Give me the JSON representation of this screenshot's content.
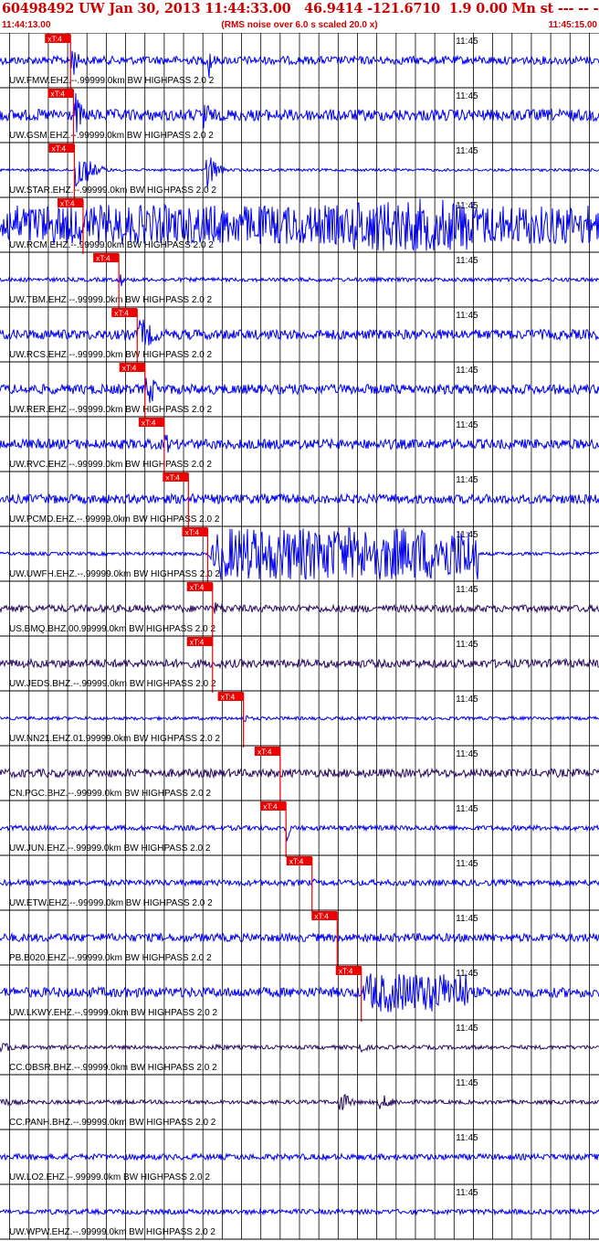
{
  "header": {
    "title": "60498492 UW Jan 30, 2013 11:44:33.00   46.9414 -121.6710  1.9 0.00 Mn st --- -- --  -1",
    "start_time": "11:44:13.00",
    "rms_note": "(RMS noise over 6.0 s scaled 20.0 x)",
    "end_time": "11:45:15.00"
  },
  "colors": {
    "trace_blue": "#0000ee",
    "trace_purple": "#2a0a60",
    "pick_marker": "#ee0000",
    "pick_label_text": "#ffffff",
    "grid": "#000000",
    "title_red": "#cc0000"
  },
  "chart_data": {
    "type": "line",
    "title": "60498492 UW Jan 30, 2013 11:44:33.00   46.9414 -121.6710  1.9 0.00 Mn st --- -- --  -1",
    "x_axis": {
      "start": "11:44:13.00",
      "end": "11:45:15.00",
      "minute_tick_label": "11:45",
      "minute_tick_time": "11:45:00"
    },
    "pick_label": "xT:4",
    "grid": "vertical gridlines every 2 s",
    "traces": [
      {
        "label": "UW.FMW.EHZ.--.99999.0km BW  HIGHPASS  2.0  2",
        "color": "trace_blue",
        "pick_time": "11:44:20.3",
        "amplitude": 0.25,
        "bursts": [
          [
            20.3,
            1.6,
            1.9
          ],
          [
            34.5,
            1.2,
            1.9
          ]
        ]
      },
      {
        "label": "UW.GSM.EHZ.--.99999.0km BW  HIGHPASS  2.0  2",
        "color": "trace_blue",
        "pick_time": "11:44:20.6",
        "amplitude": 0.35,
        "bursts": [
          [
            20.6,
            2.2,
            2.0
          ],
          [
            34.0,
            1.5,
            2.0
          ]
        ]
      },
      {
        "label": "UW.STAR.EHZ.--.99999.0km BW  HIGHPASS  2.0  2",
        "color": "trace_blue",
        "pick_time": "11:44:20.7",
        "amplitude": 0.08,
        "bursts": [
          [
            20.7,
            4.0,
            1.9
          ],
          [
            34.3,
            2.5,
            1.9
          ]
        ]
      },
      {
        "label": "UW.RCM.EHZ.--.99999.0km BW  HIGHPASS  2.0  2",
        "color": "trace_blue",
        "pick_time": "11:44:21.6",
        "amplitude": 1.2,
        "bursts": [
          [
            21.6,
            40.0,
            1.2
          ],
          [
            49.0,
            13.0,
            1.9
          ]
        ]
      },
      {
        "label": "UW.TBM.EHZ.--.99999.0km BW  HIGHPASS  2.0  2",
        "color": "trace_blue",
        "pick_time": "11:44:25.3",
        "amplitude": 0.12,
        "bursts": [
          [
            25.3,
            0.6,
            1.6
          ]
        ]
      },
      {
        "label": "UW.RCS.EHZ.--.99999.0km BW  HIGHPASS  2.0  2",
        "color": "trace_blue",
        "pick_time": "11:44:27.2",
        "amplitude": 0.3,
        "bursts": [
          [
            27.2,
            5.0,
            1.4
          ]
        ]
      },
      {
        "label": "UW.RER.EHZ.--.99999.0km BW  HIGHPASS  2.0  2",
        "color": "trace_blue",
        "pick_time": "11:44:28.0",
        "amplitude": 0.3,
        "bursts": [
          [
            28.0,
            4.0,
            1.3
          ]
        ]
      },
      {
        "label": "UW.RVC.EHZ.--.99999.0km BW  HIGHPASS  2.0  2",
        "color": "trace_blue",
        "pick_time": "11:44:30.0",
        "amplitude": 0.3,
        "bursts": [
          [
            30.0,
            1.5,
            1.2
          ]
        ]
      },
      {
        "label": "UW.PCMD.EHZ.--.99999.0km BW  HIGHPASS  2.0  2",
        "color": "trace_blue",
        "pick_time": "11:44:32.5",
        "amplitude": 0.28,
        "bursts": [
          [
            32.5,
            1.5,
            0.8
          ]
        ]
      },
      {
        "label": "UW.UWFH.EHZ.--.99999.0km BW  HIGHPASS  2.0  2",
        "color": "trace_blue",
        "pick_time": "11:44:34.5",
        "amplitude": 0.1,
        "bursts": [
          [
            34.5,
            28.0,
            1.9
          ]
        ]
      },
      {
        "label": "US.BMQ.BHZ.00.99999.0km BW  HIGHPASS  2.0  2",
        "color": "trace_purple",
        "pick_time": "11:44:35.0",
        "amplitude": 0.22,
        "bursts": [
          [
            35.0,
            6.0,
            0.5
          ]
        ]
      },
      {
        "label": "UW.JEDS.BHZ.--.99999.0km BW  HIGHPASS  2.0  2",
        "color": "trace_purple",
        "pick_time": "11:44:35.0",
        "amplitude": 0.25,
        "bursts": []
      },
      {
        "label": "UW.NN21.EHZ.01.99999.0km BW  HIGHPASS  2.0  2",
        "color": "trace_blue",
        "pick_time": "11:44:38.2",
        "amplitude": 0.1,
        "bursts": [
          [
            38.2,
            1.2,
            0.5
          ]
        ]
      },
      {
        "label": "CN.PGC.BHZ.--.99999.0km BW  HIGHPASS  2.0  2",
        "color": "trace_purple",
        "pick_time": "11:44:42.0",
        "amplitude": 0.25,
        "bursts": []
      },
      {
        "label": "UW.JUN.EHZ.--.99999.0km BW  HIGHPASS  2.0  2",
        "color": "trace_blue",
        "pick_time": "11:44:42.6",
        "amplitude": 0.15,
        "bursts": [
          [
            42.6,
            0.8,
            1.5
          ]
        ]
      },
      {
        "label": "UW.ETW.EHZ.--.99999.0km BW  HIGHPASS  2.0  2",
        "color": "trace_blue",
        "pick_time": "11:44:45.3",
        "amplitude": 0.18,
        "bursts": [
          [
            45.3,
            0.8,
            0.5
          ]
        ]
      },
      {
        "label": "PB.B020.EHZ.--.99999.0km BW  HIGHPASS  2.0  2",
        "color": "trace_blue",
        "pick_time": "11:44:47.9",
        "amplitude": 0.25,
        "bursts": []
      },
      {
        "label": "UW.LKWY.EHZ.--.99999.0km BW  HIGHPASS  2.0  2",
        "color": "trace_blue",
        "pick_time": "11:44:50.4",
        "amplitude": 0.3,
        "bursts": [
          [
            50.4,
            11.0,
            1.2
          ]
        ]
      },
      {
        "label": "CC.OBSR.BHZ.--.99999.0km BW  HIGHPASS  2.0  2",
        "color": "trace_purple",
        "pick_time": null,
        "amplitude": 0.12,
        "bursts": [
          [
            8.0,
            9.0,
            1.7
          ],
          [
            35.0,
            6.0,
            0.3
          ],
          [
            50.0,
            3.0,
            0.5
          ]
        ]
      },
      {
        "label": "CC.PANH.BHZ.--.99999.0km BW  HIGHPASS  2.0  2",
        "color": "trace_purple",
        "pick_time": null,
        "amplitude": 0.12,
        "bursts": [
          [
            8.0,
            9.0,
            1.5
          ],
          [
            48.0,
            3.0,
            1.0
          ],
          [
            52.0,
            6.0,
            0.6
          ]
        ]
      },
      {
        "label": "UW.LO2.EHZ.--.99999.0km BW  HIGHPASS  2.0  2",
        "color": "trace_blue",
        "pick_time": null,
        "amplitude": 0.18,
        "bursts": [
          [
            10.0,
            8.0,
            0.6
          ]
        ]
      },
      {
        "label": "UW.WPW.EHZ.--.99999.0km BW  HIGHPASS  2.0  2",
        "color": "trace_blue",
        "pick_time": null,
        "amplitude": 0.15,
        "bursts": []
      }
    ]
  }
}
